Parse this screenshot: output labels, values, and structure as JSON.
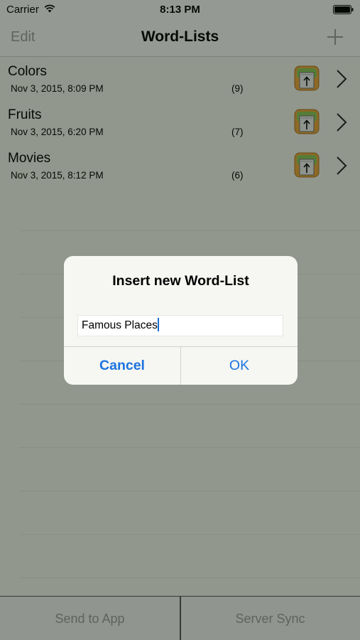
{
  "status": {
    "carrier": "Carrier",
    "time": "8:13 PM"
  },
  "nav": {
    "edit_label": "Edit",
    "title": "Word-Lists",
    "add_icon": "plus-icon"
  },
  "lists": [
    {
      "title": "Colors",
      "date": "Nov 3, 2015, 8:09 PM",
      "count": "(9)"
    },
    {
      "title": "Fruits",
      "date": "Nov 3, 2015, 6:20 PM",
      "count": "(7)"
    },
    {
      "title": "Movies",
      "date": "Nov 3, 2015, 8:12 PM",
      "count": "(6)"
    }
  ],
  "toolbar": {
    "send_label": "Send to App",
    "sync_label": "Server Sync"
  },
  "dialog": {
    "title": "Insert new Word-List",
    "input_value": "Famous Places",
    "cancel_label": "Cancel",
    "ok_label": "OK"
  },
  "colors": {
    "accent": "#1b74e0",
    "disabled": "#9b9b9b",
    "background": "#f0f3ea"
  }
}
